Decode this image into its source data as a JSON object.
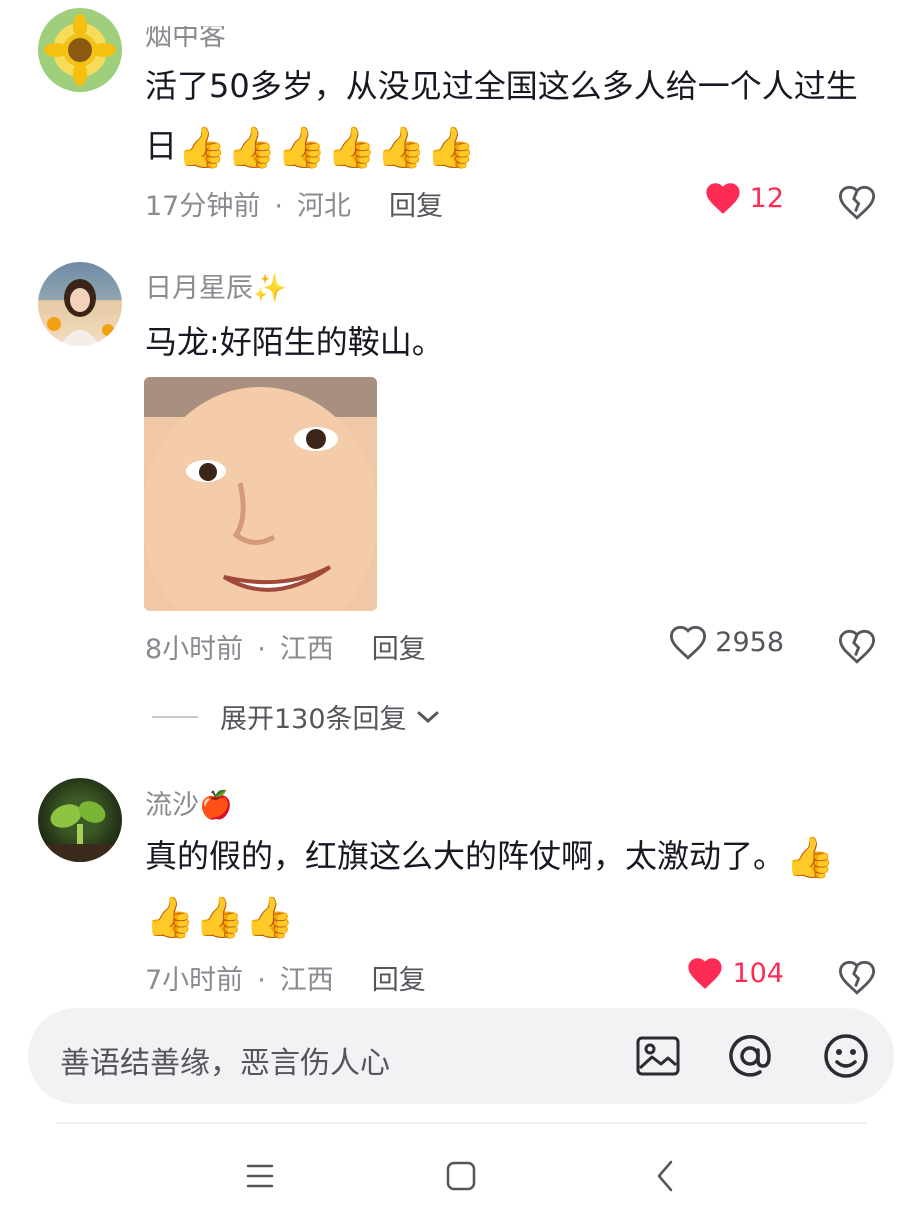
{
  "comments": [
    {
      "username": "烟中客",
      "text": "活了50多岁，从没见过全国这么多人给一个人过生日",
      "emojis": [
        "👍",
        "👍",
        "👍",
        "👍",
        "👍",
        "👍"
      ],
      "time": "17分钟前",
      "location": "河北",
      "reply_label": "回复",
      "likes": "12",
      "liked": true,
      "avatar_icon": "sunflower-avatar"
    },
    {
      "username": "日月星辰✨",
      "text": "马龙:好陌生的鞍山。",
      "image_icon": "smiling-face-meme",
      "time": "8小时前",
      "location": "江西",
      "reply_label": "回复",
      "likes": "2958",
      "liked": false,
      "expand_label": "展开130条回复",
      "avatar_icon": "girl-portrait-avatar"
    },
    {
      "username": "流沙🍎",
      "text": "真的假的，红旗这么大的阵仗啊，太激动了。",
      "emojis_inline": [
        "👍"
      ],
      "emojis": [
        "👍",
        "👍",
        "👍"
      ],
      "time": "7小时前",
      "location": "江西",
      "reply_label": "回复",
      "likes": "104",
      "liked": true,
      "avatar_icon": "sprout-avatar"
    }
  ],
  "input": {
    "placeholder": "善语结善缘，恶言伤人心"
  },
  "colors": {
    "accent": "#fe2c55",
    "meta": "#8a8b91",
    "input_bg": "#f2f2f4"
  }
}
